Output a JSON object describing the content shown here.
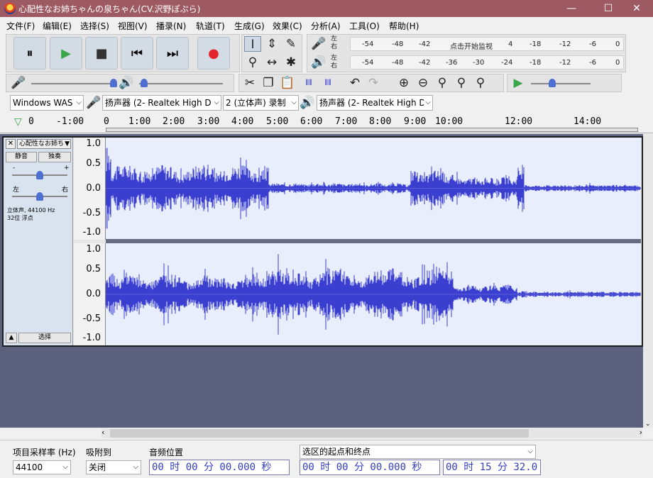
{
  "window": {
    "title": "心配性なお姉ちゃんの泉ちゃん(CV.沢野ぽぷら)",
    "minimize": "—",
    "maximize": "☐",
    "close": "✕"
  },
  "menu": [
    "文件(F)",
    "编辑(E)",
    "选择(S)",
    "视图(V)",
    "播录(N)",
    "轨道(T)",
    "生成(G)",
    "效果(C)",
    "分析(A)",
    "工具(O)",
    "帮助(H)"
  ],
  "transport": {
    "pause": "⏸",
    "play": "▶",
    "stop": "■",
    "skip_start": "⏮",
    "skip_end": "⏭",
    "record": "●"
  },
  "meters": {
    "record_ticks": [
      "-54",
      "-48",
      "-42",
      "点击开始监视",
      "4",
      "-18",
      "-12",
      "-6",
      "0"
    ],
    "playback_ticks": [
      "-54",
      "-48",
      "-42",
      "-36",
      "-30",
      "-24",
      "-18",
      "-12",
      "-6",
      "0"
    ],
    "left": "左",
    "right": "右"
  },
  "devices": {
    "host": "Windows WAS",
    "recording_device": "扬声器 (2- Realtek High D",
    "channels": "2 (立体声) 录制",
    "playback_device": "扬声器 (2- Realtek High D"
  },
  "ruler": {
    "ticks": [
      "-1:00",
      "0",
      "1:00",
      "2:00",
      "3:00",
      "4:00",
      "5:00",
      "6:00",
      "7:00",
      "8:00",
      "9:00",
      "10:00",
      "12:00",
      "14:00"
    ],
    "zero_top": "0"
  },
  "track": {
    "name": "心配性なお姉ちゃ",
    "mute": "静音",
    "solo": "独奏",
    "gain_minus": "-",
    "gain_plus": "+",
    "pan_left": "左",
    "pan_right": "右",
    "info_line1": "立体声, 44100 Hz",
    "info_line2": "32位 浮点",
    "select": "选择",
    "gain_level": 0.5,
    "pan_level": 0.5
  },
  "axis_labels": [
    "1.0",
    "0.5",
    "0.0",
    "-0.5",
    "-1.0"
  ],
  "bottom": {
    "rate_label": "项目采样率 (Hz)",
    "rate_value": "44100",
    "snap_label": "吸附到",
    "snap_value": "关闭",
    "audio_pos_label": "音频位置",
    "audio_pos_value": "00 时 00 分 00.000 秒",
    "selection_label": "选区的起点和终点",
    "sel_start": "00 时 00 分 00.000 秒",
    "sel_end": "00 时 15 分 32.0"
  },
  "colors": {
    "title_bar": "#9d5a63",
    "waveform": "#3a3fd0",
    "track_bg": "#5b607c"
  }
}
